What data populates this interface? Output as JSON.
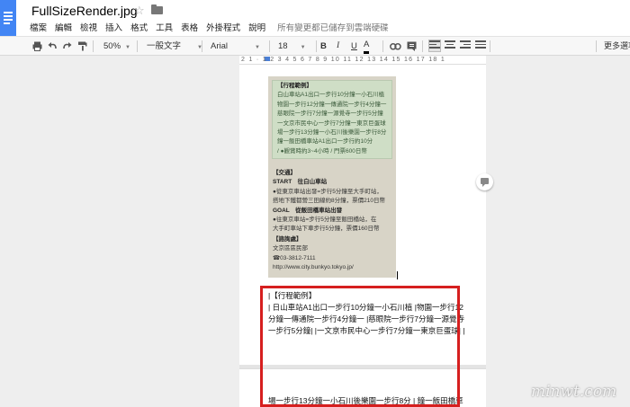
{
  "header": {
    "title": "FullSizeRender.jpg",
    "menu": [
      "檔案",
      "編輯",
      "檢視",
      "插入",
      "格式",
      "工具",
      "表格",
      "外掛程式",
      "說明"
    ],
    "save_status": "所有變更都已儲存到雲端硬碟"
  },
  "toolbar": {
    "zoom": "50%",
    "style": "一般文字",
    "font": "Arial",
    "size": "18",
    "bold": "B",
    "italic": "I",
    "underline": "U",
    "font_color": "A",
    "more": "更多選項"
  },
  "ruler": {
    "numbers": "2 1 · 1 2 3 4 5 6 7 8 9 10 11 12 13 14 15 16 17 18 1"
  },
  "photo": {
    "box_lines": [
      "【行程範例】",
      "白山車站A1出口一步行10分鐘一小石川植",
      "物園一步行12分鐘一傳通院一步行4分鐘一",
      "慈眼院一步行7分鐘一源覺寺一步行5分鐘",
      "一文京市民中心一步行7分鐘一東京巨蛋球",
      "場一步行13分鐘一小石川後樂園一步行8分",
      "鐘一飯田橋車站A1出口一步行約10分",
      "/ ●觀賞時約3~4小時 / 門票600日幣"
    ],
    "transport_lines": [
      "【交通】",
      "START　往白山車站",
      "●從東京車站出發=步行5分鐘至大手町站，",
      "搭地下鐵都營三田線約8分鐘，票價210日幣",
      "GOAL　從飯田橋車站出發",
      "●往東京車站=步行5分鐘至飯田橋站，在",
      "大手町車站下車步行5分鐘，票價160日幣"
    ],
    "contact_lines": [
      "【諮詢處】",
      "文京區區民部",
      "☎03-3812-7111",
      "http://www.city.bunkyo.tokyo.jp/"
    ]
  },
  "ocr_text": {
    "line1": "|【行程範例】",
    "line2": "| 日山車站A1出口一步行10分鐘一小石川植 |物園一步行12",
    "line3": "分鐘一傳通院一步行4分鐘一 |慈眼院一步行7分鐘一源覺寺",
    "line4": "一步行5分鐘| |一文京市民中心一步行7分鐘一東京巨蛋球| |",
    "line5": "場一步行13分鐘一小石川後樂園一步行8分 | 鐘一飯田橋車"
  },
  "watermark": "minwt.com"
}
